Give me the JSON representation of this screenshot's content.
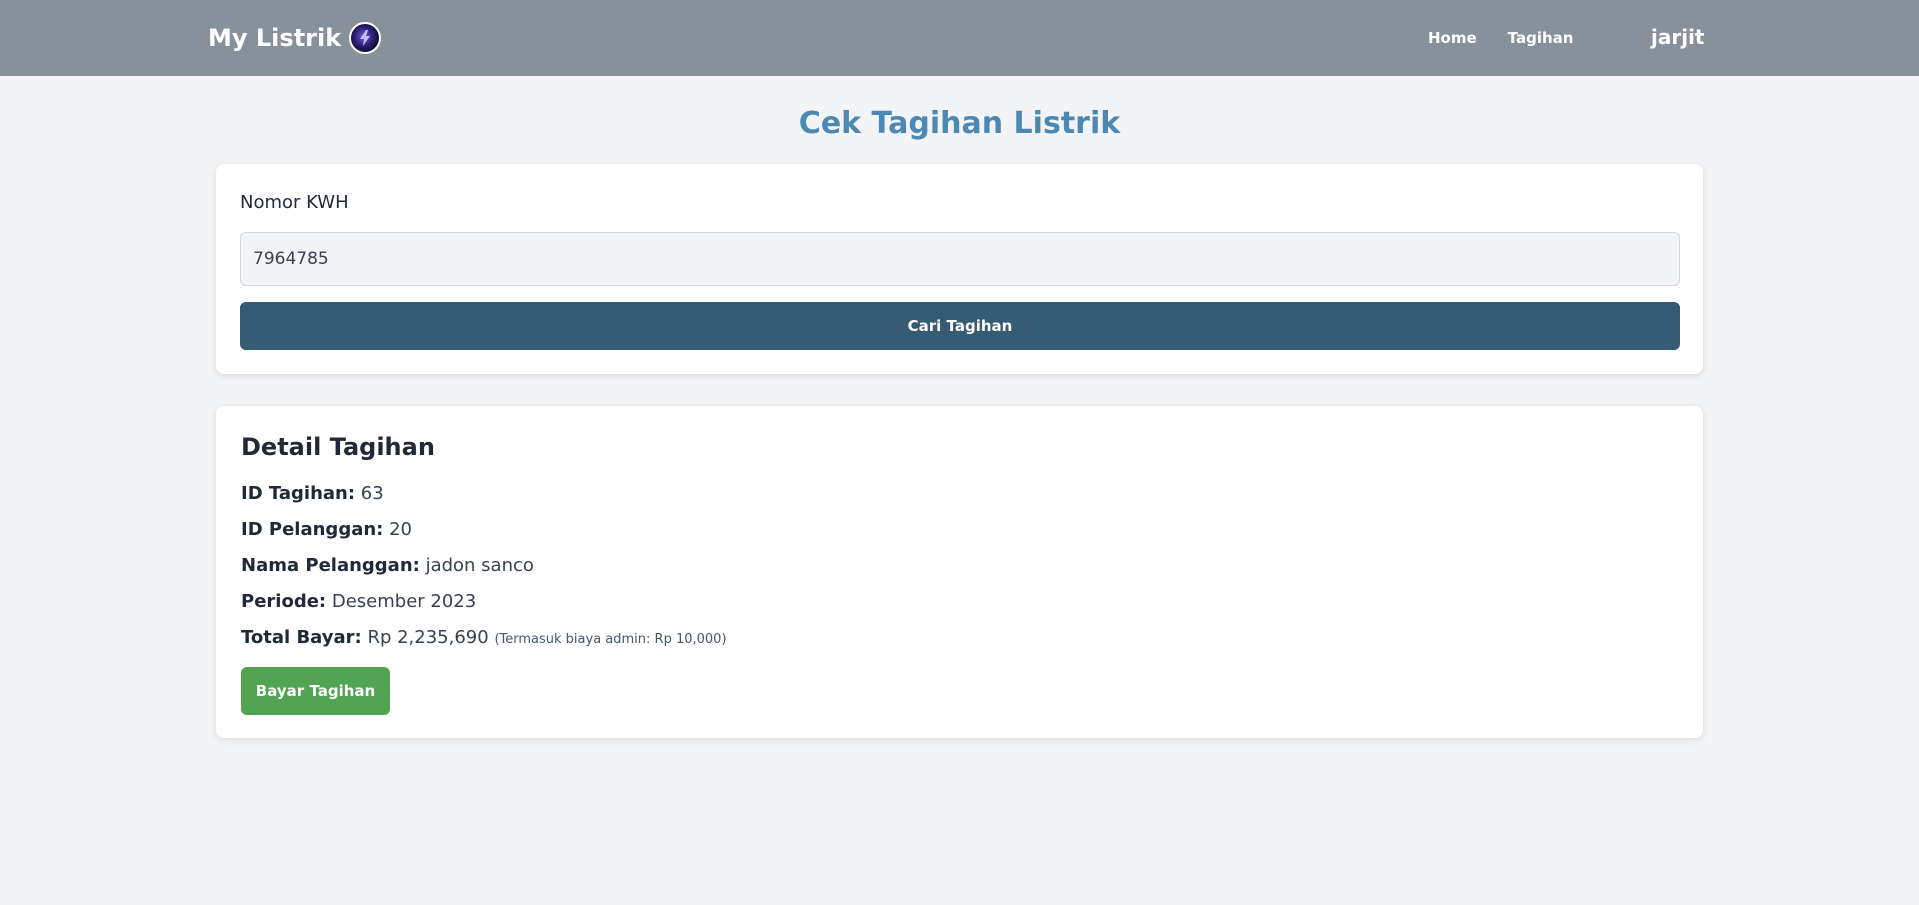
{
  "navbar": {
    "brand": "My Listrik",
    "brand_logo_icon": "lightning-orb-icon",
    "links": [
      "Home",
      "Tagihan"
    ],
    "user": "jarjit",
    "background": "#87919c"
  },
  "page": {
    "title": "Cek Tagihan Listrik",
    "title_color": "#4b88b4"
  },
  "search": {
    "label": "Nomor KWH",
    "input_value": "7964785",
    "button_label": "Cari Tagihan",
    "button_color": "#365b74"
  },
  "detail": {
    "title": "Detail Tagihan",
    "rows": [
      {
        "label": "ID Tagihan:",
        "value": "63"
      },
      {
        "label": "ID Pelanggan:",
        "value": "20"
      },
      {
        "label": "Nama Pelanggan:",
        "value": "jadon sanco"
      },
      {
        "label": "Periode:",
        "value": "Desember 2023"
      },
      {
        "label": "Total Bayar:",
        "value": "Rp 2,235,690",
        "note": "(Termasuk biaya admin: Rp 10,000)"
      }
    ],
    "pay_button_label": "Bayar Tagihan",
    "pay_button_color": "#52a452"
  }
}
